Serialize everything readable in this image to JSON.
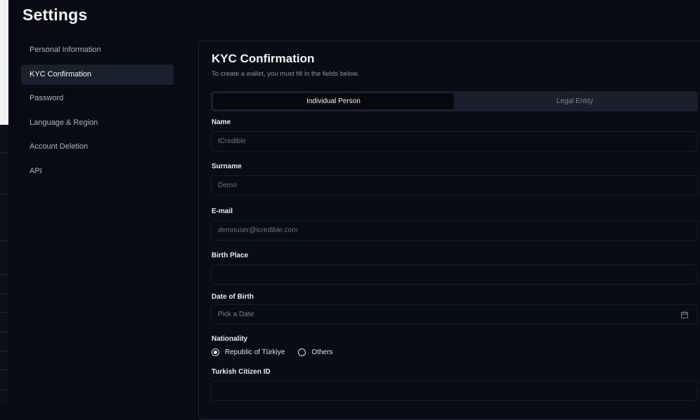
{
  "page": {
    "title": "Settings"
  },
  "sidebar": {
    "items": [
      {
        "label": "Personal Information",
        "active": false
      },
      {
        "label": "KYC Confirmation",
        "active": true
      },
      {
        "label": "Password",
        "active": false
      },
      {
        "label": "Language & Region",
        "active": false
      },
      {
        "label": "Account Deletion",
        "active": false
      },
      {
        "label": "API",
        "active": false
      }
    ]
  },
  "kyc": {
    "title": "KYC Confirmation",
    "subtitle": "To create a wallet, you must fill in the fields below.",
    "tabs": [
      {
        "label": "Individual Person",
        "selected": true
      },
      {
        "label": "Legal Entity",
        "selected": false
      }
    ],
    "fields": {
      "name": {
        "label": "Name",
        "placeholder": "ICredible",
        "value": ""
      },
      "surname": {
        "label": "Surname",
        "placeholder": "Demo",
        "value": ""
      },
      "email": {
        "label": "E-mail",
        "placeholder": "demouser@icredible.com",
        "value": ""
      },
      "birth_place": {
        "label": "Birth Place",
        "placeholder": "",
        "value": ""
      },
      "date_of_birth": {
        "label": "Date of Birth",
        "placeholder": "Pick a Date",
        "icon": "calendar-icon"
      },
      "turkish_citizen_id": {
        "label": "Turkish Citizen ID",
        "placeholder": "",
        "value": ""
      }
    },
    "nationality": {
      "label": "Nationality",
      "options": [
        {
          "label": "Republic of Türkiye",
          "checked": true
        },
        {
          "label": "Others",
          "checked": false
        }
      ]
    }
  },
  "colors": {
    "background": "#070b14",
    "active_item": "#1a202c",
    "border": "#1c2330",
    "text_primary": "#f3f4f7",
    "text_muted": "#8b92a0"
  }
}
